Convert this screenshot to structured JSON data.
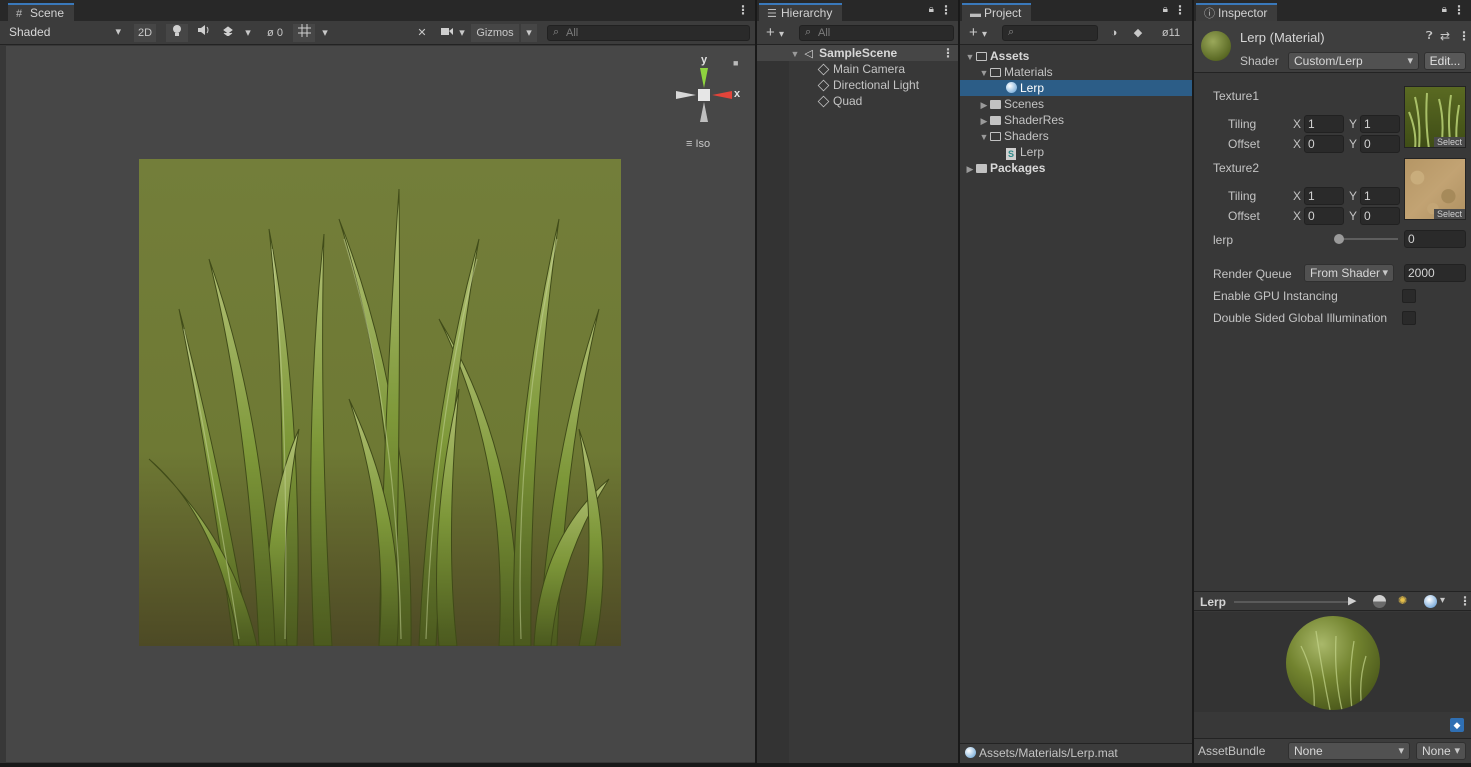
{
  "scene": {
    "tab": "Scene",
    "shading_mode": "Shaded",
    "mode_2d": "2D",
    "hidden_count": "0",
    "gizmos_label": "Gizmos",
    "search_placeholder": "All",
    "axis_y": "y",
    "axis_x": "x",
    "projection": "Iso"
  },
  "hierarchy": {
    "tab": "Hierarchy",
    "search_placeholder": "All",
    "scene_name": "SampleScene",
    "items": [
      "Main Camera",
      "Directional Light",
      "Quad"
    ]
  },
  "project": {
    "tab": "Project",
    "hidden_count": "11",
    "tree": {
      "assets": "Assets",
      "materials": "Materials",
      "lerp_material": "Lerp",
      "scenes": "Scenes",
      "shaderres": "ShaderRes",
      "shaders": "Shaders",
      "lerp_shader": "Lerp",
      "packages": "Packages"
    },
    "footer_path": "Assets/Materials/Lerp.mat"
  },
  "inspector": {
    "tab": "Inspector",
    "title": "Lerp (Material)",
    "shader_label": "Shader",
    "shader_value": "Custom/Lerp",
    "edit_button": "Edit...",
    "texture1": {
      "label": "Texture1",
      "tiling_label": "Tiling",
      "offset_label": "Offset",
      "tiling_x": "1",
      "tiling_y": "1",
      "offset_x": "0",
      "offset_y": "0",
      "select": "Select"
    },
    "texture2": {
      "label": "Texture2",
      "tiling_label": "Tiling",
      "offset_label": "Offset",
      "tiling_x": "1",
      "tiling_y": "1",
      "offset_x": "0",
      "offset_y": "0",
      "select": "Select"
    },
    "x_label": "X",
    "y_label": "Y",
    "lerp_label": "lerp",
    "lerp_value": "0",
    "render_queue_label": "Render Queue",
    "render_queue_mode": "From Shader",
    "render_queue_value": "2000",
    "gpu_instancing_label": "Enable GPU Instancing",
    "double_sided_label": "Double Sided Global Illumination",
    "preview_title": "Lerp",
    "assetbundle_label": "AssetBundle",
    "assetbundle_value": "None",
    "assetbundle_variant": "None"
  },
  "colors": {
    "accent": "#3a79bb",
    "selection": "#2c5d87",
    "panel": "#383838",
    "grass_base": "#6f7a35"
  }
}
